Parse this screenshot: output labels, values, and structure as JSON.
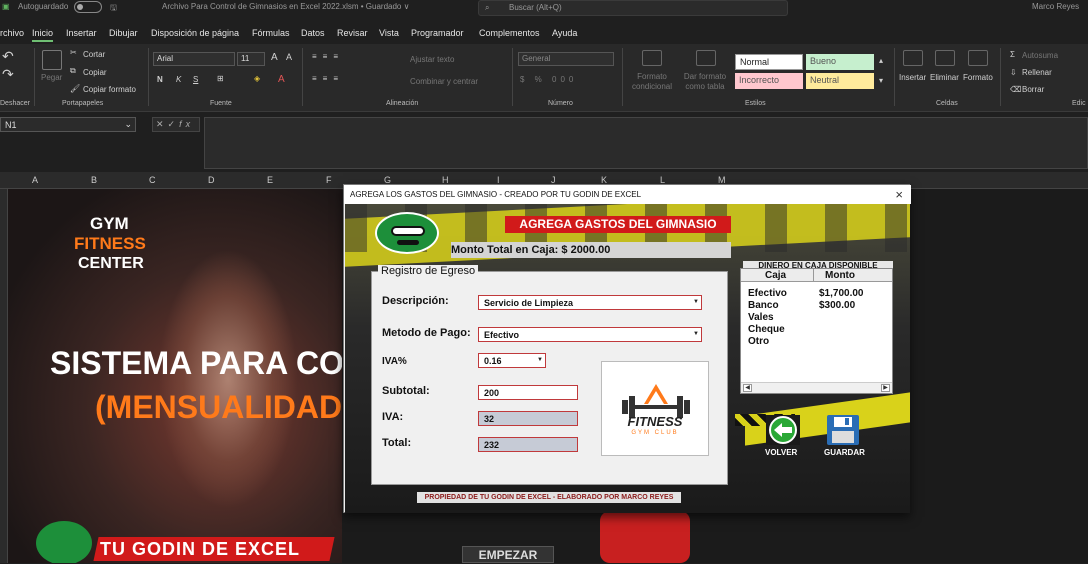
{
  "titlebar": {
    "autosave": "Autoguardado",
    "file_title": "Archivo Para Control de Gimnasios en Excel 2022.xlsm • Guardado ∨",
    "search_placeholder": "Buscar (Alt+Q)",
    "user": "Marco Reyes"
  },
  "menu": [
    "rchivo",
    "Inicio",
    "Insertar",
    "Dibujar",
    "Disposición de página",
    "Fórmulas",
    "Datos",
    "Revisar",
    "Vista",
    "Programador",
    "Complementos",
    "Ayuda"
  ],
  "ribbon": {
    "undo_group": "Deshacer",
    "clipboard": {
      "paste": "Pegar",
      "cut": "Cortar",
      "copy": "Copiar",
      "format_painter": "Copiar formato",
      "group": "Portapapeles"
    },
    "font": {
      "name": "Arial",
      "size": "11",
      "bold": "N",
      "italic": "K",
      "underline": "S",
      "group": "Fuente"
    },
    "alignment": {
      "wrap": "Ajustar texto",
      "merge": "Combinar y centrar",
      "group": "Alineación"
    },
    "number": {
      "format": "General",
      "group": "Número"
    },
    "styles": {
      "cond": "Formato condicional",
      "table": "Dar formato como tabla",
      "normal": "Normal",
      "bueno": "Bueno",
      "incorrecto": "Incorrecto",
      "neutral": "Neutral",
      "group": "Estilos"
    },
    "cells": {
      "insert": "Insertar",
      "delete": "Eliminar",
      "format": "Formato",
      "group": "Celdas"
    },
    "editing": {
      "autosum": "Autosuma",
      "fill": "Rellenar",
      "clear": "Borrar",
      "group": "Edic"
    }
  },
  "namebox": "N1",
  "fx": "fx",
  "columns": [
    "A",
    "B",
    "C",
    "D",
    "E",
    "F",
    "G",
    "H",
    "I",
    "J",
    "K",
    "L",
    "M"
  ],
  "sheet": {
    "gym": "GYM",
    "fitness": "FITNESS",
    "center": "CENTER",
    "sistema": "SISTEMA PARA CO",
    "mensualidad": "(MENSUALIDAD",
    "godin": "TU GODIN DE EXCEL",
    "empezar": "EMPEZAR"
  },
  "dialog": {
    "title": "AGREGA LOS GASTOS DEL GIMNASIO - CREADO POR TU GODIN DE EXCEL",
    "close": "×",
    "banner": "AGREGA GASTOS DEL GIMNASIO",
    "monto_total": "Monto Total en Caja: $ 2000.00",
    "frame_title": "Registro de Egreso",
    "labels": {
      "descripcion": "Descripción:",
      "metodo": "Metodo de Pago:",
      "iva_pct": "IVA%",
      "subtotal": "Subtotal:",
      "iva": "IVA:",
      "total": "Total:"
    },
    "values": {
      "descripcion": "Servicio de Limpieza",
      "metodo": "Efectivo",
      "iva_pct": "0.16",
      "subtotal": "200",
      "iva": "32",
      "total": "232"
    },
    "logo": {
      "brand": "FITNESS",
      "sub": "GYM CLUB"
    },
    "propiedad": "PROPIEDAD DE TU GODIN DE EXCEL - ELABORADO POR MARCO REYES",
    "dinero_title": "DINERO EN CAJA DISPONIBLE",
    "list_headers": [
      "Caja",
      "Monto"
    ],
    "list_rows": [
      {
        "caja": "Efectivo",
        "monto": "$1,700.00"
      },
      {
        "caja": "Banco",
        "monto": "$300.00"
      },
      {
        "caja": "Vales",
        "monto": ""
      },
      {
        "caja": "Cheque",
        "monto": ""
      },
      {
        "caja": "Otro",
        "monto": ""
      }
    ],
    "volver": "VOLVER",
    "guardar": "GUARDAR"
  },
  "colors": {
    "accent_green": "#6fbf73",
    "banner_red": "#d11a1a",
    "stripe_yellow": "#d9d21a",
    "orange": "#ff7a1a"
  }
}
